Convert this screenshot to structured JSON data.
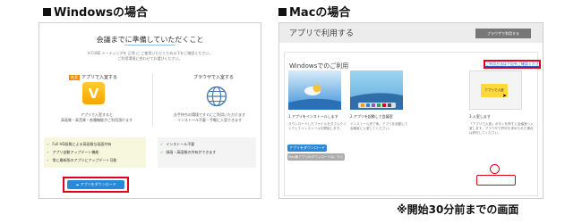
{
  "windows": {
    "section_title": "Windowsの場合",
    "heading": "会議までに準備していただくこと",
    "note_line1": "V-CUBE ミーティングを 正常 に ご使用いただくため以下をご確認ください。",
    "note_line2": "ご利用環境に合わせてお選びください。",
    "option_app_label": "アプリで入室する",
    "option_app_badge": "推奨",
    "option_browser_label": "ブラウザで入室する",
    "app_icon_letter": "V",
    "app_desc_line1": "アプリで入室すると",
    "app_desc_line2": "高画質・高音質・各種機能がご利用頂けます",
    "browser_desc_line1": "お手持ちの環境ですぐにご利用いただけます",
    "browser_desc_line2": "インストール不要・手軽に入室できます",
    "app_features": [
      "Full HD画質による高画質な画面共有",
      "アプリ自動アップデート機能",
      "常に最新版のアプリにアップデート可能"
    ],
    "browser_features": [
      "インストール不要",
      "録画・高画質の共有ができます"
    ],
    "download_button": "アプリをダウンロード"
  },
  "mac": {
    "section_title": "Macの場合",
    "app_title": "アプリで利用する",
    "browser_button": "ブラウザで利用する",
    "subheading": "Windowsでのご利用",
    "corner_link": "ご利用方法は下記をご確認ください",
    "steps": [
      {
        "label": "1.アプリをインストールします",
        "desc": "ダウンロードしたファイルをダブルクリックしてインストールを開始します。"
      },
      {
        "label": "2.アプリを起動して会議室",
        "desc": "インストール完了後、アプリを起動して会議室に入室してください。"
      },
      {
        "label": "3.入室します",
        "desc": "「アプリで入室」ボタンを押すと会議室へ入室します。ブラウザで許可を求められた場合は許可してください。"
      }
    ],
    "download_button": "アプリをダウンロード",
    "download_button_alt": "Mac版アプリのダウンロードはこちら",
    "step3_button": "アプリで入室"
  },
  "footer_note": "※開始30分前までの画面",
  "colors": {
    "accent_red": "#e2001a",
    "link_blue": "#2a88d8",
    "app_orange": "#f7a400"
  }
}
